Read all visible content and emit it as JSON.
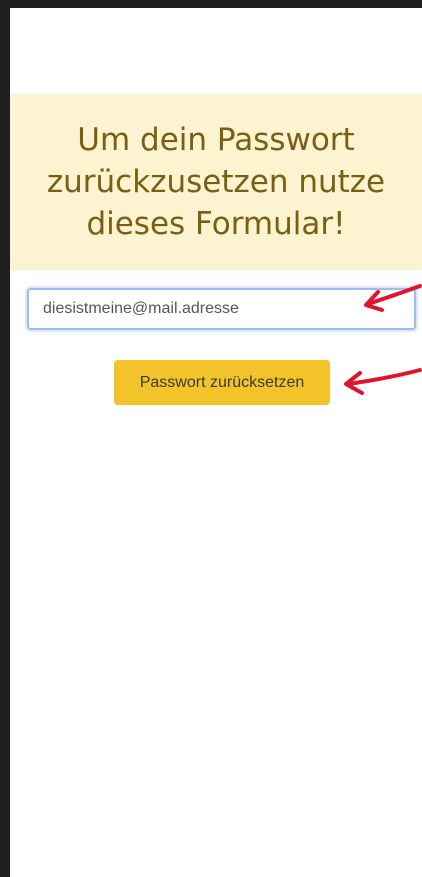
{
  "banner": {
    "heading": "Um dein Passwort zurückzusetzen nutze dieses Formular!"
  },
  "form": {
    "email_value": "diesistmeine@mail.adresse",
    "submit_label": "Passwort zurücksetzen"
  },
  "colors": {
    "banner_background": "#fcf3d0",
    "heading_text": "#7a5f13",
    "button_background": "#f2c42a",
    "input_border": "#9dbcf1",
    "annotation_arrow": "#e0142b",
    "frame": "#1f1f1f"
  },
  "annotations": {
    "arrow_icon": "red-arrow-pointing-left"
  }
}
